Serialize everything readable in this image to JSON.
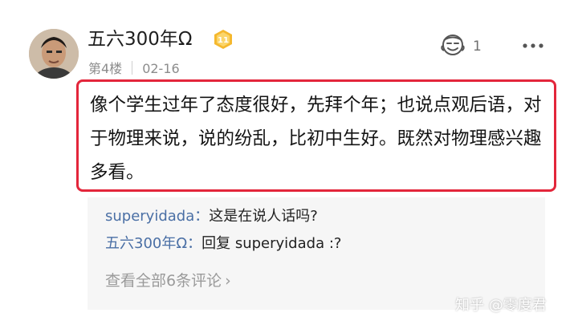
{
  "post": {
    "username": "五六300年Ω",
    "badge_level": "11",
    "floor": "第4楼",
    "date": "02-16",
    "like_count": "1",
    "comment_text": "像个学生过年了态度很好，先拜个年；也说点观后语，对于物理来说，说的纷乱，比初中生好。既然对物理感兴趣多看。"
  },
  "replies": {
    "items": [
      {
        "name": "superyidada：",
        "content": "这是在说人话吗?"
      },
      {
        "name": "五六300年Ω：",
        "content": "回复 superyidada :?"
      }
    ],
    "view_all_label": "查看全部6条评论",
    "view_all_arrow": "›"
  },
  "watermark": "知乎 @零度君",
  "colors": {
    "highlight_border": "#e3263b",
    "reply_name": "#4a6fa5",
    "badge": "#f5b82e"
  },
  "icons": {
    "like": "like-icon",
    "more": "more-options-icon",
    "badge": "level-badge-icon"
  }
}
